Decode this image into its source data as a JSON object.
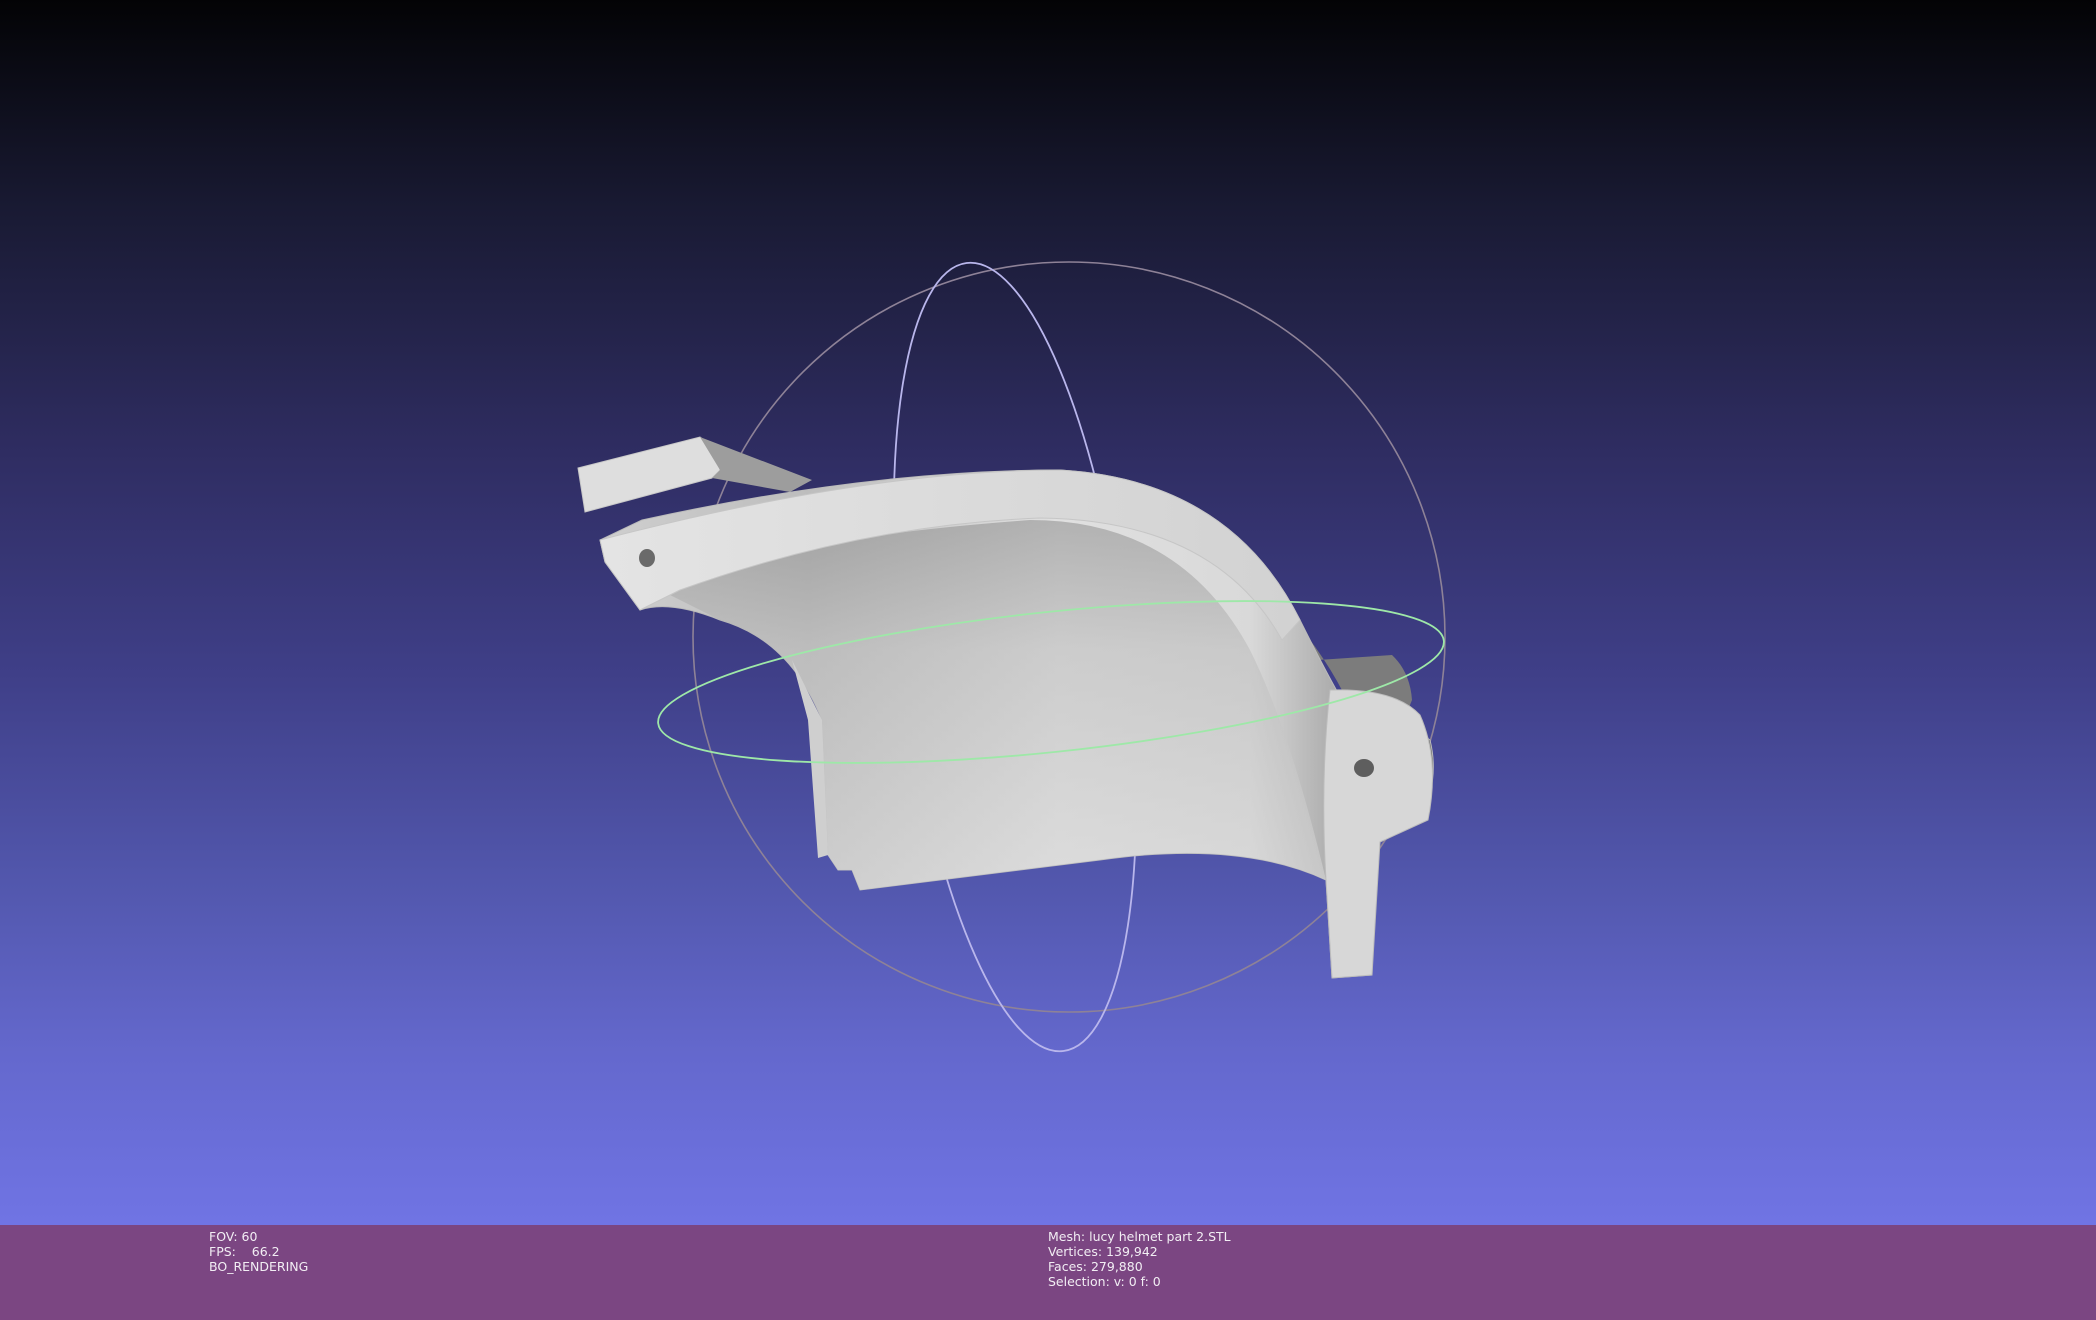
{
  "viewer": {
    "background_top": "#030305",
    "background_bottom": "#7074e4",
    "mesh_color": "#d6d6d6",
    "info_bar_color": "#7b4682",
    "trackball_colors": {
      "vertical_ring": "#b9b6ec",
      "horizontal_ring": "#9ee8a8",
      "outer_ring": "#9a8a9e"
    },
    "widgets": [
      "trackball",
      "mesh-render"
    ]
  },
  "info_left": {
    "fov": "FOV: 60",
    "fps_label": "FPS:",
    "fps_value": "66.2",
    "render_mode": "BO_RENDERING"
  },
  "info_right": {
    "mesh": "Mesh: lucy helmet part 2.STL",
    "vertices": "Vertices: 139,942",
    "faces": "Faces: 279,880",
    "selection": "Selection: v: 0 f: 0"
  }
}
